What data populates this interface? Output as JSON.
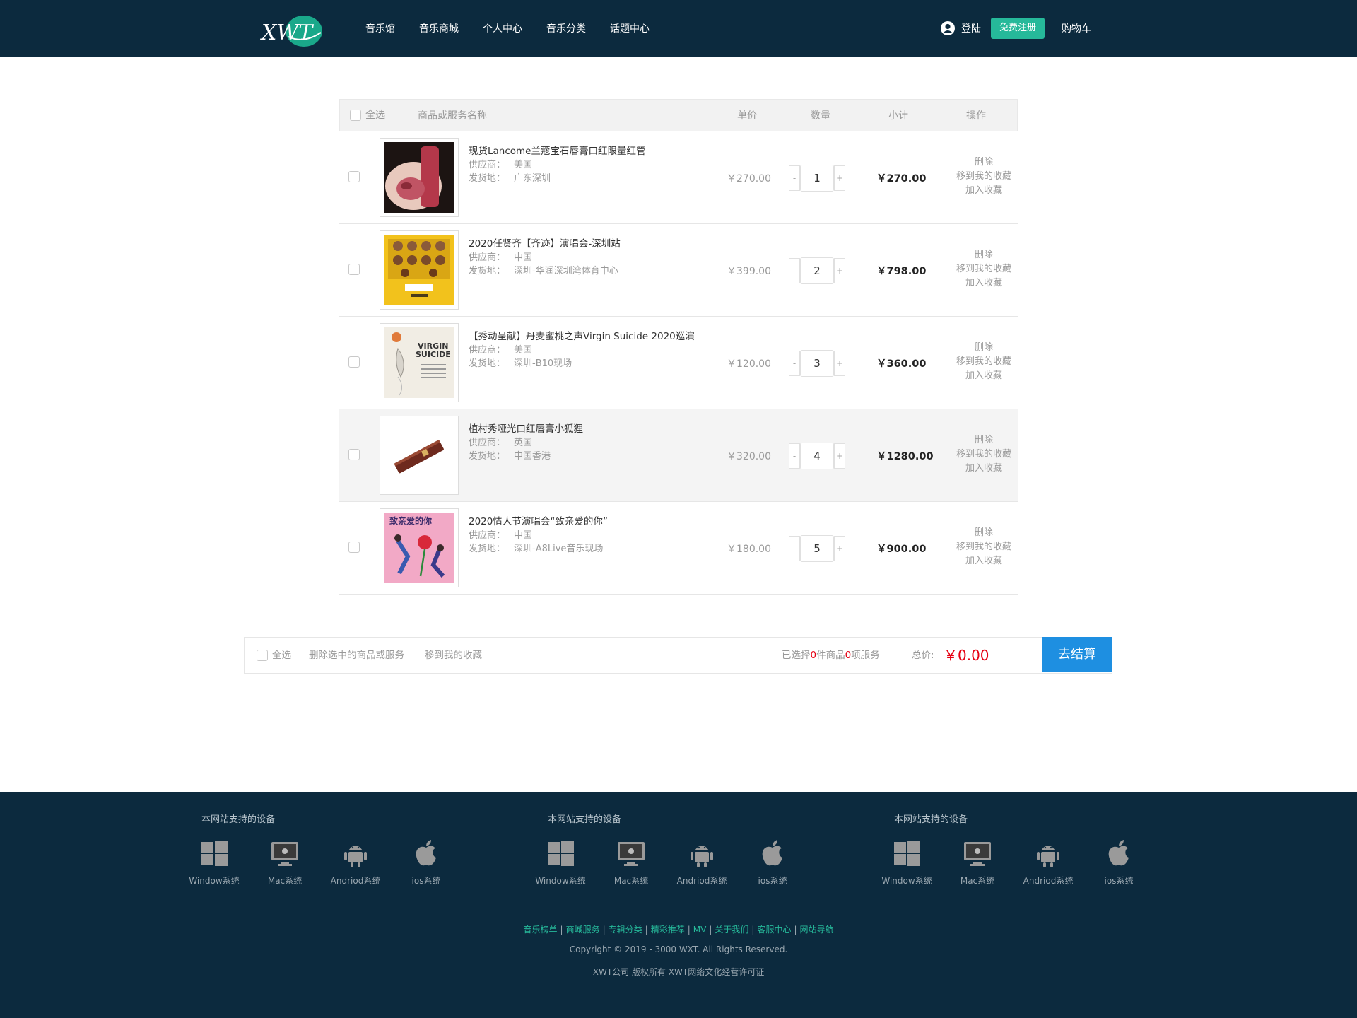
{
  "header": {
    "logo_text": "XWT",
    "nav": [
      "音乐馆",
      "音乐商城",
      "个人中心",
      "音乐分类",
      "话题中心"
    ],
    "login": "登陆",
    "register": "免费注册",
    "cart": "购物车"
  },
  "cart_head": {
    "select_all": "全选",
    "name": "商品或服务名称",
    "price": "单价",
    "qty": "数量",
    "subtotal": "小计",
    "ops": "操作"
  },
  "labels": {
    "supplier": "供应商：",
    "ship_from": "发货地：",
    "op_delete": "删除",
    "op_move": "移到我的收藏",
    "op_fav": "加入收藏",
    "minus": "-",
    "plus": "+"
  },
  "items": [
    {
      "title": "现货Lancome兰蔻宝石唇膏口红限量红管",
      "supplier": "美国",
      "ship_from": "广东深圳",
      "price": "￥270.00",
      "qty": "1",
      "subtotal": "￥270.00",
      "image": "lipstick-photo"
    },
    {
      "title": "2020任贤齐【齐迹】演唱会-深圳站",
      "supplier": "中国",
      "ship_from": "深圳-华润深圳湾体育中心",
      "price": "￥399.00",
      "qty": "2",
      "subtotal": "￥798.00",
      "image": "concert-poster-yellow"
    },
    {
      "title": "【秀动呈献】丹麦蜜桃之声Virgin Suicide 2020巡演",
      "supplier": "美国",
      "ship_from": "深圳-B10现场",
      "price": "￥120.00",
      "qty": "3",
      "subtotal": "￥360.00",
      "image": "virgin-suicide-poster"
    },
    {
      "title": "植村秀哑光口红唇膏小狐狸",
      "supplier": "英国",
      "ship_from": "中国香港",
      "price": "￥320.00",
      "qty": "4",
      "subtotal": "￥1280.00",
      "image": "lipstick-case-photo"
    },
    {
      "title": "2020情人节演唱会“致亲爱的你”",
      "supplier": "中国",
      "ship_from": "深圳-A8Live音乐现场",
      "price": "￥180.00",
      "qty": "5",
      "subtotal": "￥900.00",
      "image": "valentine-poster-pink"
    }
  ],
  "poster_text": {
    "virgin_suicide": [
      "VIRGIN",
      "SUICIDE"
    ],
    "valentine": "致亲爱的你"
  },
  "bar": {
    "select_all": "全选",
    "delete_selected": "删除选中的商品或服务",
    "move_fav": "移到我的收藏",
    "selected_prefix": "已选择",
    "selected_goods": "0",
    "selected_mid": "件商品",
    "selected_services": "0",
    "selected_suffix": "项服务",
    "total_label": "总价:",
    "total": "￥0.00",
    "checkout": "去结算"
  },
  "footer": {
    "device_title": "本网站支持的设备",
    "devices": [
      "Window系统",
      "Mac系统",
      "Andriod系统",
      "ios系统"
    ],
    "links": [
      "音乐榜单",
      "商城服务",
      "专辑分类",
      "精彩推荐",
      "MV",
      "关于我们",
      "客服中心",
      "网站导航"
    ],
    "copyright": "Copyright © 2019 - 3000 WXT. All Rights Reserved.",
    "license": "XWT公司 版权所有 XWT网络文化经营许可证"
  },
  "colors": {
    "header_bg": "#0c2a3e",
    "accent_green": "#26b99a",
    "checkout_blue": "#1e8fe1",
    "price_red": "#e60012"
  }
}
